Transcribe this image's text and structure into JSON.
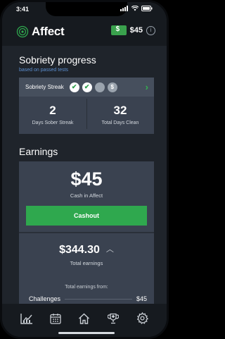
{
  "status": {
    "time": "3:41"
  },
  "header": {
    "app_name": "Affect",
    "balance": "$45",
    "info_glyph": "i"
  },
  "sobriety": {
    "title": "Sobriety progress",
    "subtitle": "based on passed tests",
    "streak_label": "Sobriety Streak",
    "streak_dots": [
      "done",
      "done",
      "pending",
      "money"
    ],
    "days_sober_streak": "2",
    "days_sober_streak_label": "Days Sober Streak",
    "total_days_clean": "32",
    "total_days_clean_label": "Total Days Clean"
  },
  "earnings": {
    "title": "Earnings",
    "cash_amount": "$45",
    "cash_label": "Cash in Affect",
    "cashout_label": "Cashout",
    "total_amount": "$344.30",
    "total_label": "Total earnings",
    "from_label": "Total earnings from:",
    "from_rows": [
      {
        "label": "Challenges",
        "amount": "$45"
      }
    ]
  },
  "colors": {
    "accent_green": "#2fa84e",
    "subtitle_blue": "#5c8fd1",
    "card_bg": "#3a4250",
    "page_bg": "#1f242b"
  },
  "tabbar": {
    "icons": [
      "chart-icon",
      "calendar-icon",
      "home-icon",
      "trophy-icon",
      "gear-icon"
    ]
  }
}
